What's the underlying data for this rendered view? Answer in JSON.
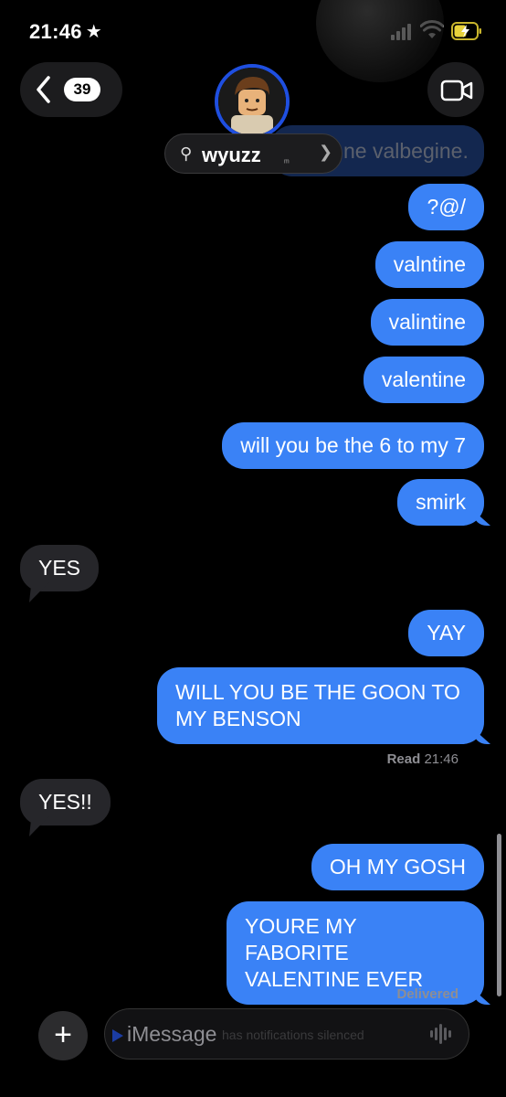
{
  "status": {
    "time": "21:46"
  },
  "nav": {
    "back_count": "39",
    "contact_name": "wyuzz",
    "contact_subtext": "ᵐ"
  },
  "faded_message": "ne valbegine.",
  "messages": [
    {
      "dir": "out",
      "text": "?@/"
    },
    {
      "dir": "out",
      "text": "valntine"
    },
    {
      "dir": "out",
      "text": "valintine"
    },
    {
      "dir": "out",
      "text": "valentine"
    },
    {
      "dir": "out",
      "text": "will you be the 6 to my 7"
    },
    {
      "dir": "out",
      "text": "smirk"
    },
    {
      "dir": "in",
      "text": "YES"
    },
    {
      "dir": "out",
      "text": "YAY"
    },
    {
      "dir": "out",
      "text": "WILL YOU BE THE GOON TO MY BENSON"
    },
    {
      "dir": "in",
      "text": "YES!!"
    },
    {
      "dir": "out",
      "text": "OH MY GOSH"
    },
    {
      "dir": "out",
      "text": "YOURE MY FABORITE VALENTINE EVER"
    }
  ],
  "receipts": {
    "read_label": "Read",
    "read_time": "21:46",
    "delivered": "Delivered"
  },
  "composer": {
    "placeholder": "iMessage",
    "subtle_note": "has notifications silenced"
  },
  "colors": {
    "bubble_out": "#3a82f6",
    "bubble_in": "#26262a",
    "avatar_ring": "#1f4fe0"
  }
}
